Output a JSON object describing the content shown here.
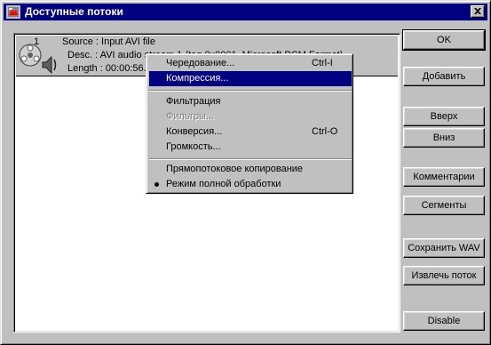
{
  "window": {
    "title": "Доступные потоки"
  },
  "stream": {
    "number": "1",
    "source": "Source : Input AVI file",
    "desc": "Desc. : AVI audio stream 1 (tag 0x0001, Microsoft PCM Format)",
    "length": "Length : 00:00:56.4"
  },
  "buttons": {
    "ok": "OK",
    "add": "Добавить",
    "up": "Вверх",
    "down": "Вниз",
    "comments": "Комментарии",
    "segments": "Сегменты",
    "save_wav": "Сохранить WAV",
    "extract": "Извлечь поток",
    "disable": "Disable"
  },
  "menu": {
    "interleave": {
      "label": "Чередование...",
      "shortcut": "Ctrl-I"
    },
    "compression": {
      "label": "Компрессия..."
    },
    "filtering": {
      "label": "Фильтрация"
    },
    "filters": {
      "label": "Фильтры..."
    },
    "conversion": {
      "label": "Конверсия...",
      "shortcut": "Ctrl-O"
    },
    "volume": {
      "label": "Громкость..."
    },
    "direct_copy": {
      "label": "Прямопотоковое копирование"
    },
    "full_processing": {
      "label": "Режим полной обработки"
    }
  },
  "colors": {
    "titlebar": "#000080",
    "face": "#c0c0c0",
    "highlight": "#000080"
  },
  "icons": {
    "title": "app-icon",
    "close": "close-icon",
    "stream": "audio-film-reel-icon"
  }
}
